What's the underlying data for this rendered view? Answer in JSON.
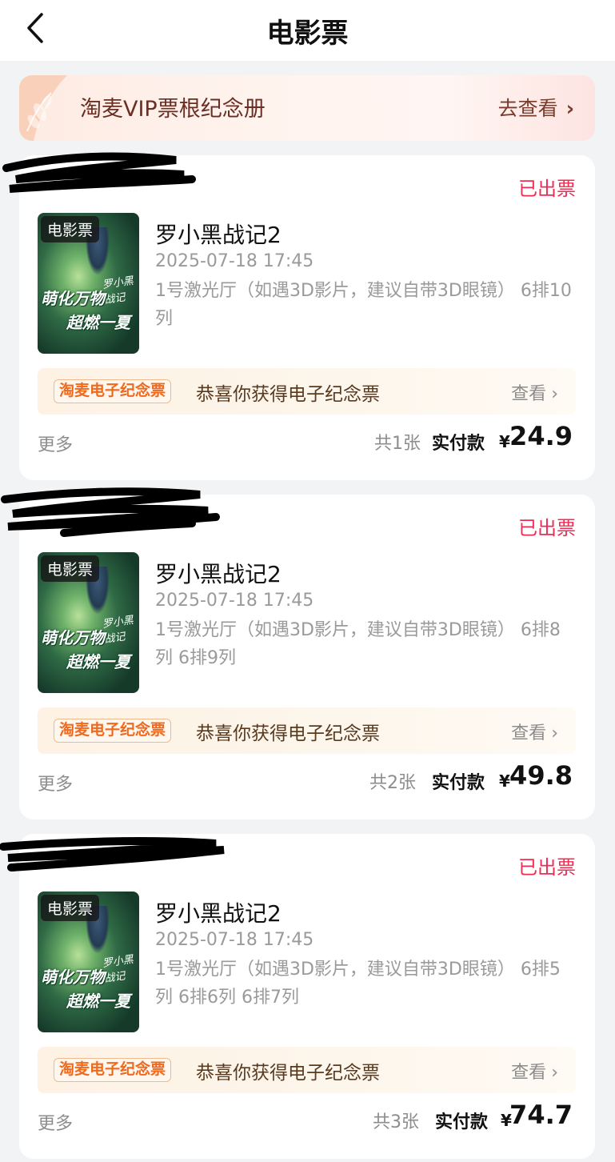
{
  "header": {
    "title": "电影票",
    "back_icon": "chevron-left-icon"
  },
  "vip_banner": {
    "title": "淘麦VIP票根纪念册",
    "link_label": "去查看",
    "link_icon": "chevron-right-icon"
  },
  "orders": [
    {
      "status": "已出票",
      "poster_tag": "电影票",
      "poster_slogan_line1": "萌化万物",
      "poster_slogan_line2": "超燃一夏",
      "poster_signature": "罗小黑战记",
      "movie_title": "罗小黑战记2",
      "show_time": "2025-07-18 17:45",
      "seat_info": "1号激光厅（如遇3D影片，建议自带3D眼镜） 6排10列",
      "souvenir_badge": "淘麦电子纪念票",
      "souvenir_text": "恭喜你获得电子纪念票",
      "souvenir_view": "查看",
      "more": "更多",
      "ticket_count": "共1张",
      "paid_label": "实付款",
      "currency": "¥",
      "price": "24.9"
    },
    {
      "status": "已出票",
      "poster_tag": "电影票",
      "poster_slogan_line1": "萌化万物",
      "poster_slogan_line2": "超燃一夏",
      "poster_signature": "罗小黑战记",
      "movie_title": "罗小黑战记2",
      "show_time": "2025-07-18 17:45",
      "seat_info": "1号激光厅（如遇3D影片，建议自带3D眼镜） 6排8列 6排9列",
      "souvenir_badge": "淘麦电子纪念票",
      "souvenir_text": "恭喜你获得电子纪念票",
      "souvenir_view": "查看",
      "more": "更多",
      "ticket_count": "共2张",
      "paid_label": "实付款",
      "currency": "¥",
      "price": "49.8"
    },
    {
      "status": "已出票",
      "poster_tag": "电影票",
      "poster_slogan_line1": "萌化万物",
      "poster_slogan_line2": "超燃一夏",
      "poster_signature": "罗小黑战记",
      "movie_title": "罗小黑战记2",
      "show_time": "2025-07-18 17:45",
      "seat_info": "1号激光厅（如遇3D影片，建议自带3D眼镜） 6排5列 6排6列 6排7列",
      "souvenir_badge": "淘麦电子纪念票",
      "souvenir_text": "恭喜你获得电子纪念票",
      "souvenir_view": "查看",
      "more": "更多",
      "ticket_count": "共3张",
      "paid_label": "实付款",
      "currency": "¥",
      "price": "74.7"
    }
  ],
  "colors": {
    "status": "#ee2d55",
    "souvenir_badge": "#ee6a1f",
    "page_background": "#f2f3f5"
  }
}
